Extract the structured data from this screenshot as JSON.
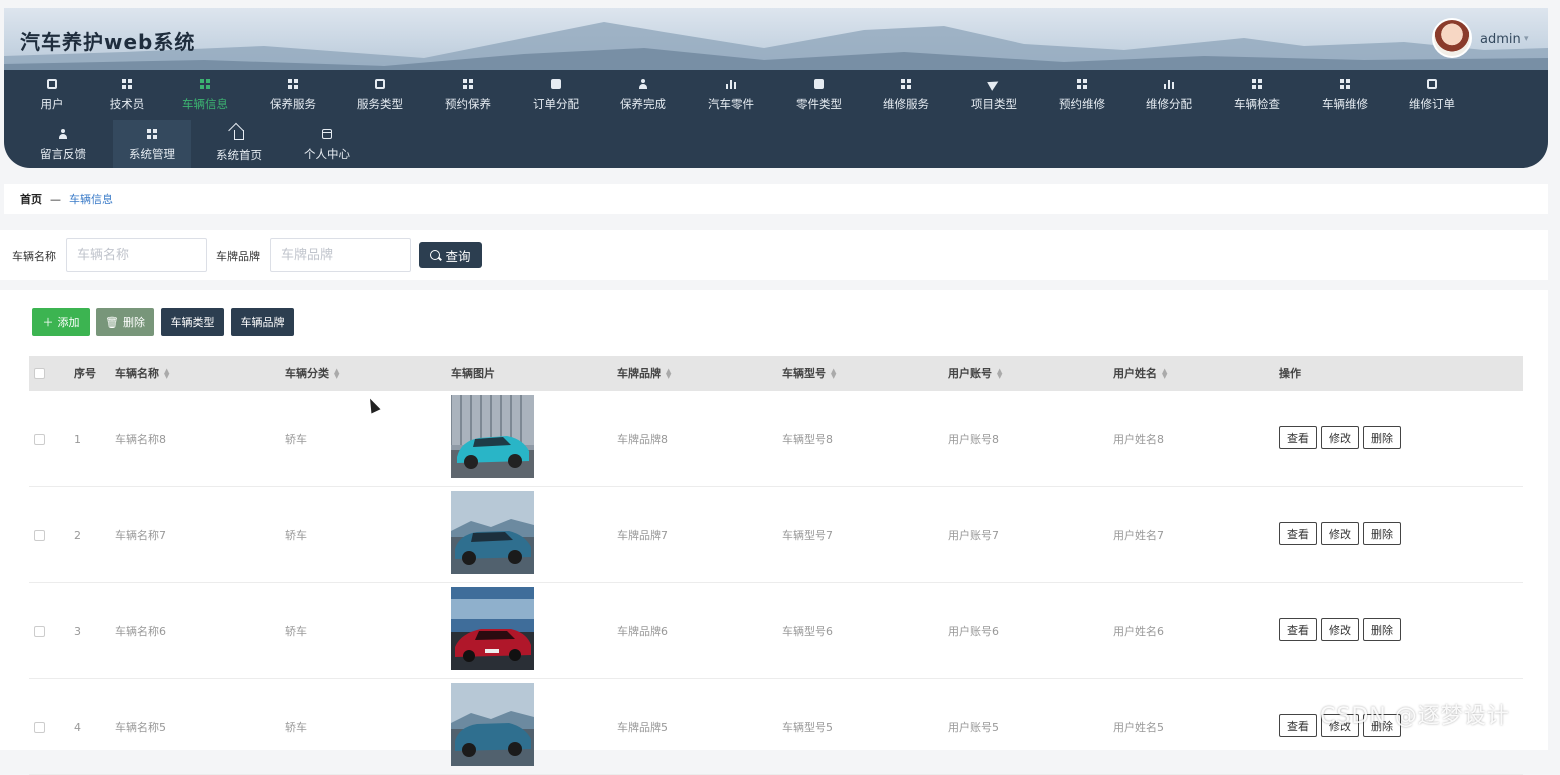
{
  "header": {
    "title": "汽车养护web系统",
    "user": "admin",
    "caret_icon": "chevron-down-icon"
  },
  "nav": {
    "row1": [
      {
        "label": "用户",
        "icon": "briefcase-icon"
      },
      {
        "label": "技术员",
        "icon": "grid-icon"
      },
      {
        "label": "车辆信息",
        "icon": "grid-icon",
        "active": true
      },
      {
        "label": "保养服务",
        "icon": "grid-icon"
      },
      {
        "label": "服务类型",
        "icon": "clipboard-icon"
      },
      {
        "label": "预约保养",
        "icon": "grid-icon"
      },
      {
        "label": "订单分配",
        "icon": "chat-icon"
      },
      {
        "label": "保养完成",
        "icon": "user-icon"
      },
      {
        "label": "汽车零件",
        "icon": "bar-chart-icon"
      },
      {
        "label": "零件类型",
        "icon": "chat-icon"
      },
      {
        "label": "维修服务",
        "icon": "grid-icon"
      },
      {
        "label": "项目类型",
        "icon": "send-icon"
      },
      {
        "label": "预约维修",
        "icon": "grid-icon"
      },
      {
        "label": "维修分配",
        "icon": "bar-chart-icon"
      },
      {
        "label": "车辆检查",
        "icon": "grid-icon"
      },
      {
        "label": "车辆维修",
        "icon": "grid-icon"
      },
      {
        "label": "维修订单",
        "icon": "clipboard-icon"
      }
    ],
    "row2": [
      {
        "label": "留言反馈",
        "icon": "user-icon"
      },
      {
        "label": "系统管理",
        "icon": "grid-icon"
      },
      {
        "label": "系统首页",
        "icon": "home-icon"
      },
      {
        "label": "个人中心",
        "icon": "card-icon"
      }
    ],
    "active_color": "#3cb371"
  },
  "breadcrumb": {
    "home": "首页",
    "separator": "—",
    "current": "车辆信息"
  },
  "search": {
    "field1_label": "车辆名称",
    "field1_placeholder": "车辆名称",
    "field2_label": "车牌品牌",
    "field2_placeholder": "车牌品牌",
    "button": "查询"
  },
  "actions": {
    "add": "添加",
    "delete": "删除",
    "vehicle_type": "车辆类型",
    "vehicle_brand": "车辆品牌"
  },
  "table": {
    "headers": [
      "序号",
      "车辆名称",
      "车辆分类",
      "车辆图片",
      "车牌品牌",
      "车辆型号",
      "用户账号",
      "用户姓名",
      "操作"
    ],
    "rows": [
      {
        "index": "1",
        "name": "车辆名称8",
        "category": "轿车",
        "brand": "车牌品牌8",
        "model": "车辆型号8",
        "account": "用户账号8",
        "username": "用户姓名8",
        "image": "teal-suv"
      },
      {
        "index": "2",
        "name": "车辆名称7",
        "category": "轿车",
        "brand": "车牌品牌7",
        "model": "车辆型号7",
        "account": "用户账号7",
        "username": "用户姓名7",
        "image": "blue-suv"
      },
      {
        "index": "3",
        "name": "车辆名称6",
        "category": "轿车",
        "brand": "车牌品牌6",
        "model": "车辆型号6",
        "account": "用户账号6",
        "username": "用户姓名6",
        "image": "red-sedan"
      },
      {
        "index": "4",
        "name": "车辆名称5",
        "category": "轿车",
        "brand": "车牌品牌5",
        "model": "车辆型号5",
        "account": "用户账号5",
        "username": "用户姓名5",
        "image": "blue-suv"
      }
    ],
    "ops": {
      "view": "查看",
      "edit": "修改",
      "delete": "删除"
    }
  },
  "watermark": "CSDN @逐梦设计"
}
